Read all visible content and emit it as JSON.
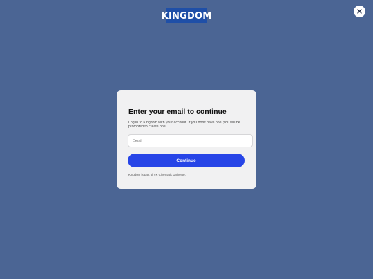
{
  "header": {
    "logo_text": "KINGDOM",
    "close_symbol": "close-icon"
  },
  "dialog": {
    "title": "Enter your email to continue",
    "description": "Log in to Kingdom with your account. If you don't have one, you will be prompted to create one.",
    "email_field": {
      "placeholder": "Email",
      "value": ""
    },
    "continue_label": "Continue",
    "footer_note": "Kingdom is part of VK Cinematic Universe."
  },
  "colors": {
    "background": "#4b6594",
    "logo_bg": "#1f4fa7",
    "card_bg": "#f1f1f2",
    "accent": "#2745e7"
  }
}
